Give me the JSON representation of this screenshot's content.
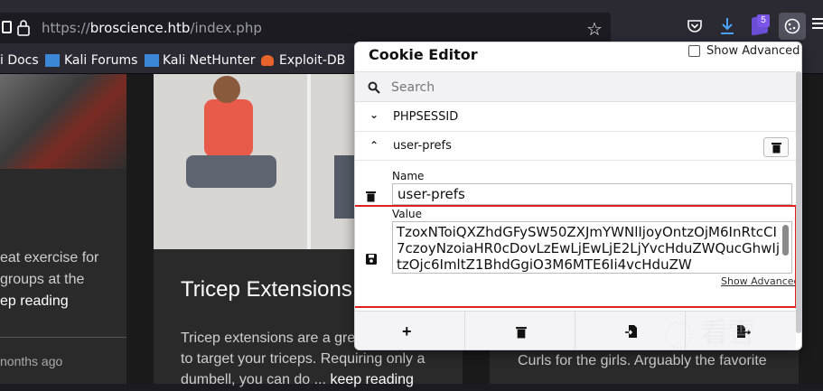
{
  "browser": {
    "url_prefix": "https://",
    "url_host": "broscience.htb",
    "url_path": "/index.php",
    "ext_badge": "5",
    "bookmarks": [
      "i Docs",
      "Kali Forums",
      "Kali NetHunter",
      "Exploit-DB"
    ]
  },
  "page": {
    "left_text": [
      "eat exercise for",
      "groups at the",
      "ep reading"
    ],
    "left_time": "nonths ago",
    "card_title": "Tricep Extensions",
    "card_lines": [
      "Tricep extensions are a gre",
      "to target your triceps. Requiring only a",
      "dumbell, you can do ..."
    ],
    "card_link": "keep reading",
    "right_card_text": "Curls for the girls. Arguably the favorite"
  },
  "popup": {
    "title": "Cookie Editor",
    "show_advanced": "Show Advanced",
    "search_placeholder": "Search",
    "cookies": [
      "PHPSESSID",
      "user-prefs"
    ],
    "name_label": "Name",
    "name_value": "user-prefs",
    "value_label": "Value",
    "value_text": "TzoxNToiQXZhdGFySW50ZXJmYWNlIjoyOntzOjM6InRtcCI7czoyNzoiaHR0cDovLzEwLjEwLjE2LjYvcHduZWQucGhwIjtzOjc6ImltZ1BhdGgiO3M6MTE6Ii4vcHduZW",
    "show_advanced_link": "Show Advanced"
  },
  "watermark": "看雪"
}
